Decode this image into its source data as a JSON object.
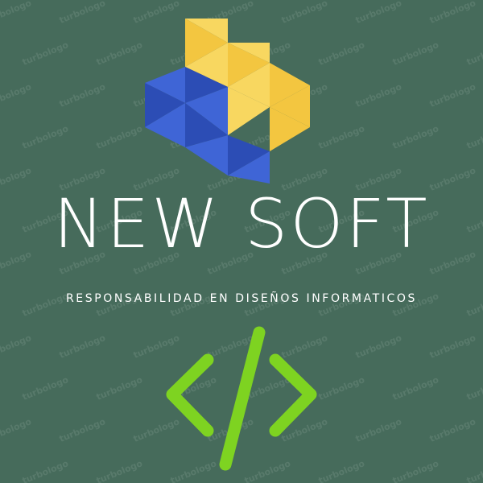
{
  "brand": {
    "name": "NEW SOFT",
    "tagline": "RESPONSABILIDAD EN DISEÑOS INFORMATICOS"
  },
  "watermark": {
    "text": "turbologo"
  },
  "icons": {
    "logo": "triangle-mosaic-logo-icon",
    "code": "code-brackets-icon"
  },
  "colors": {
    "background": "#466b5b",
    "yellow": "#f3c640",
    "yellow_light": "#f8d760",
    "blue": "#3f65d6",
    "blue_dark": "#2c4db5",
    "green": "#7ed321",
    "text": "#ffffff"
  }
}
